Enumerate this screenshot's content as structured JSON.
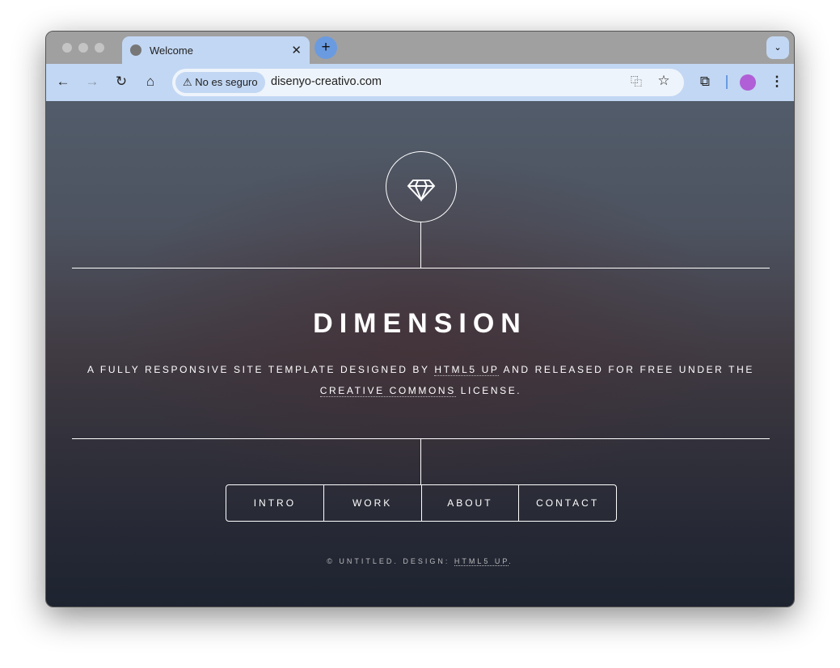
{
  "browser": {
    "tab_title": "Welcome",
    "security_label": "No es seguro",
    "url": "disenyo-creativo.com"
  },
  "page": {
    "title": "DIMENSION",
    "desc_before": "A FULLY RESPONSIVE SITE TEMPLATE DESIGNED BY ",
    "desc_link1": "HTML5 UP",
    "desc_middle": " AND RELEASED FOR FREE UNDER THE ",
    "desc_link2": "CREATIVE COMMONS",
    "desc_after": " LICENSE.",
    "nav": [
      "INTRO",
      "WORK",
      "ABOUT",
      "CONTACT"
    ],
    "footer_text": "© UNTITLED. DESIGN: ",
    "footer_link": "HTML5 UP",
    "footer_end": "."
  }
}
